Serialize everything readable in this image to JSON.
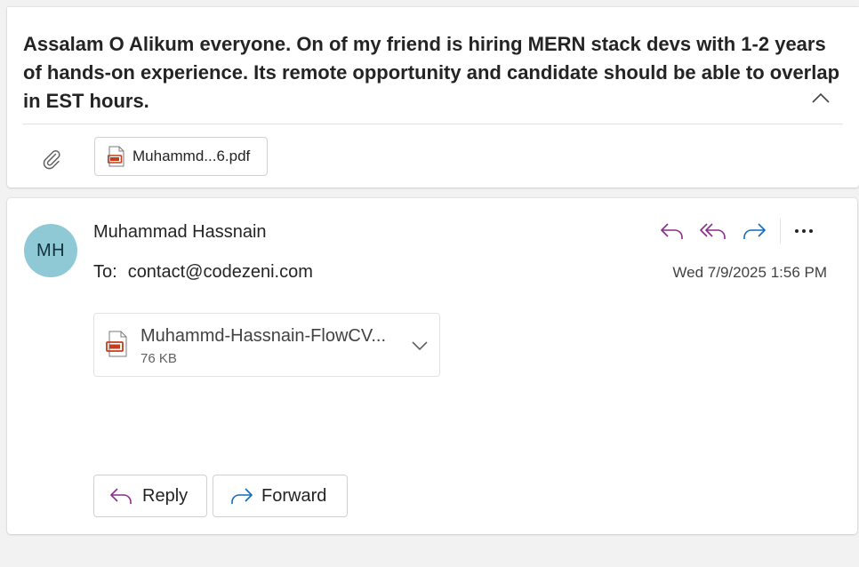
{
  "thread": {
    "subject": "Assalam O Alikum everyone. On of my friend is hiring MERN stack devs with 1-2 years of hands-on experience. Its remote opportunity and candidate should be able to overlap in EST hours.",
    "attachment_chip": {
      "filename": "Muhammd...6.pdf",
      "icon": "pdf-file-icon"
    }
  },
  "message": {
    "avatar_initials": "MH",
    "avatar_color": "#8fc9d6",
    "sender_name": "Muhammad Hassnain",
    "to_label": "To:",
    "to_address": "contact@codezeni.com",
    "timestamp": "Wed 7/9/2025 1:56 PM",
    "attachment": {
      "filename": "Muhammd-Hassnain-FlowCV...",
      "size": "76 KB",
      "icon": "pdf-file-icon"
    },
    "actions": {
      "reply_label": "Reply",
      "forward_label": "Forward"
    }
  },
  "colors": {
    "reply_accent": "#8a2c8a",
    "forward_accent": "#0f6cbd",
    "pdf_red": "#c43e1c"
  }
}
